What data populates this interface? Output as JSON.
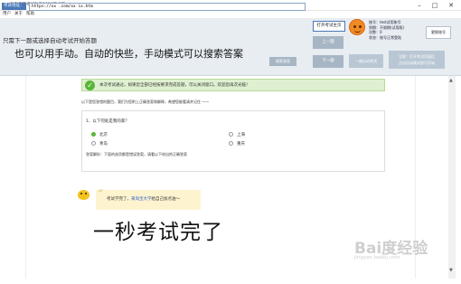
{
  "window": {
    "title": "淘宝版答考试助手2016正式版",
    "controls": [
      "–",
      "□",
      "✕"
    ]
  },
  "menu": [
    "用户",
    "关于",
    "帮助"
  ],
  "toolbar": {
    "url_label": "考试地址：",
    "url_value": "https://xx   .com/xx   ix.htm",
    "open_site_button": "打开考试主页",
    "prev_button": "上一题",
    "next_button": "下一题",
    "manual_button": "搜索答案",
    "one_click_button": "一键自动考试",
    "gray_info_lines": [
      "立即：打开考试页面后",
      "点击自动模式即可开始"
    ],
    "hint_top": "只需下一题或选择自动考试开始答题",
    "overlay_caption_1": "也可以用手动。自动的快些，手动模式可以搜索答案"
  },
  "user": {
    "lines": [
      "账号：test试用账号",
      "到期：不限期(试用版)",
      "次数：0",
      "状态：账号正常登陆"
    ],
    "change_account_button": "更换账号"
  },
  "page": {
    "success_text": "本次考试通过。如果您全部已经按要求完成答题，可以关闭窗口。欢迎您再次光临！",
    "answer_note": "以下是您答错的题目，我们为您附上正确答案和解释，希望您能看清并记住 ——",
    "question": {
      "title": "1、以下何处是我的家？",
      "options": [
        "北京",
        "青岛",
        "上海",
        "重庆"
      ],
      "selected_index": 0,
      "analysis": "答案解析：下面的选项都是错误答案，请看以下给出的正确答案"
    },
    "bubble": {
      "prefix": "考试学完了，",
      "highlight": "来淘宝大学",
      "suffix": "给自己加点油～"
    },
    "overlay_caption_2": "一秒考试完了"
  },
  "watermark": {
    "main": "Bai度经验",
    "sub": "jingyan.baidu.com"
  },
  "colors": {
    "accent": "#4a78b8",
    "success": "#5ab53a",
    "success_bg": "#dff0d0",
    "bubble_bg": "#fdf3cf",
    "toolbar_bg": "#e8edf2"
  }
}
